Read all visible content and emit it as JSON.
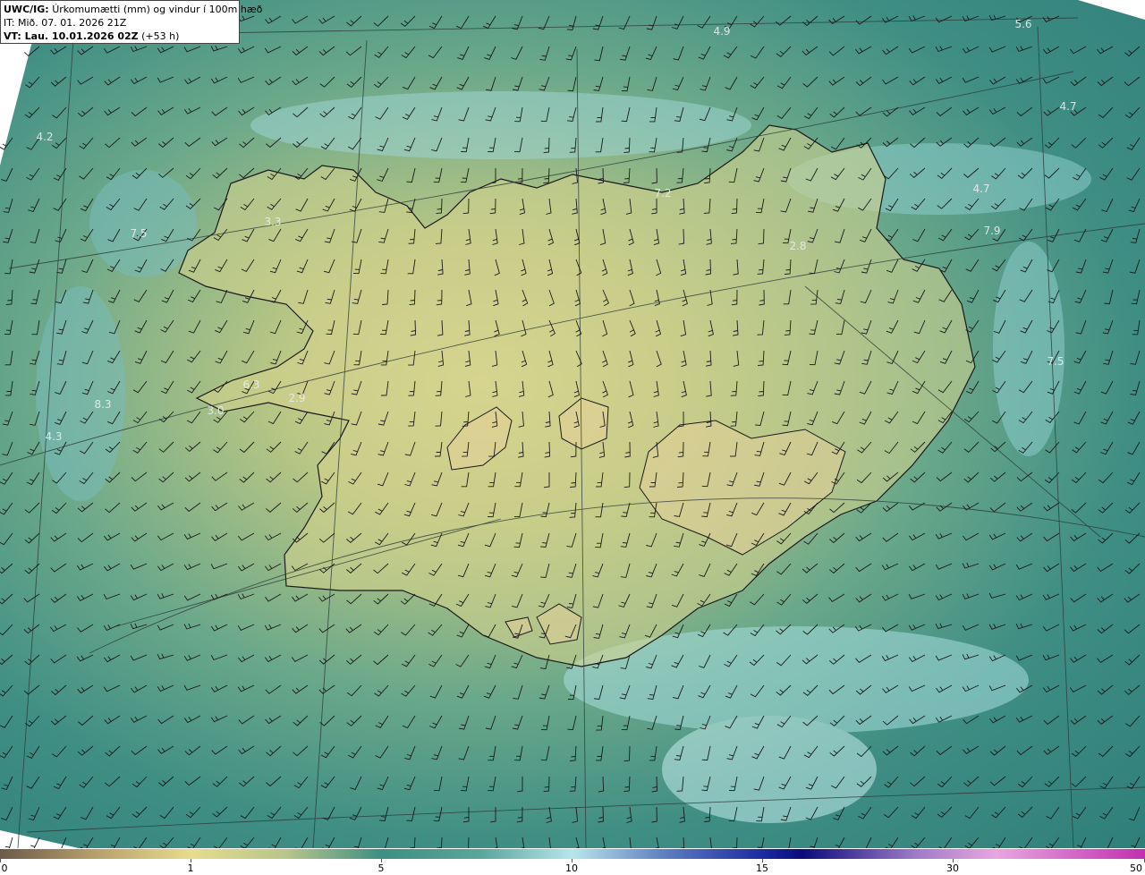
{
  "header": {
    "line1_bold": "UWC/IG:",
    "line1_text": "Úrkomumætti (mm) og vindur í 100m hæð",
    "line2": "IT: Mið. 07. 01. 2026 21Z",
    "line3_bold": "VT: Lau. 10.01.2026 02Z",
    "line3_text": "(+53 h)"
  },
  "map_labels": [
    "4.9",
    "5.6",
    "4.7",
    "4.2",
    "7.2",
    "4.7",
    "3.3",
    "7.5",
    "2.8",
    "7.9",
    "6.3",
    "2.9",
    "8.3",
    "3.0",
    "7.5",
    "4.3"
  ],
  "colorbar": {
    "ticks": [
      "0",
      "1",
      "5",
      "10",
      "15",
      "30",
      "50"
    ]
  },
  "colors": {
    "land_dry": "#d8d690",
    "sea": "#2f7f7a",
    "coast": "#1a1a1a",
    "barb": "#1a1a1a"
  }
}
